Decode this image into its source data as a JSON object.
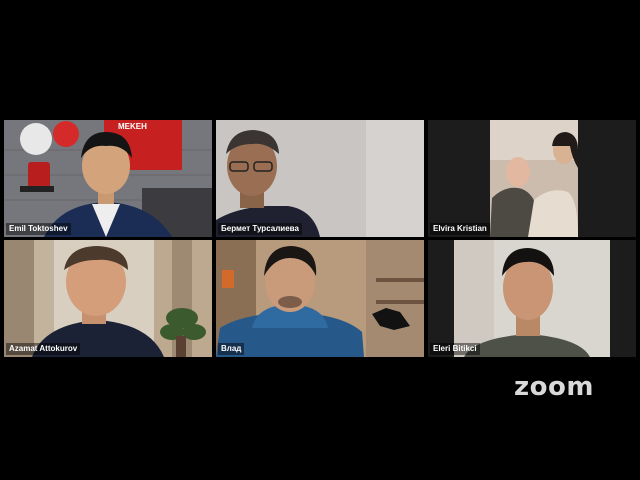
{
  "brand": {
    "logo_text": "zoom"
  },
  "banner_text": "MEKEH",
  "participants": [
    {
      "name": "Emil Toktoshev",
      "active": false
    },
    {
      "name": "Бермет Турсалиева",
      "active": false
    },
    {
      "name": "Elvira Kristian",
      "active": false
    },
    {
      "name": "Azamat Attokurov",
      "active": true
    },
    {
      "name": "Влад",
      "active": false
    },
    {
      "name": "Eleri Bitikci",
      "active": false
    }
  ]
}
